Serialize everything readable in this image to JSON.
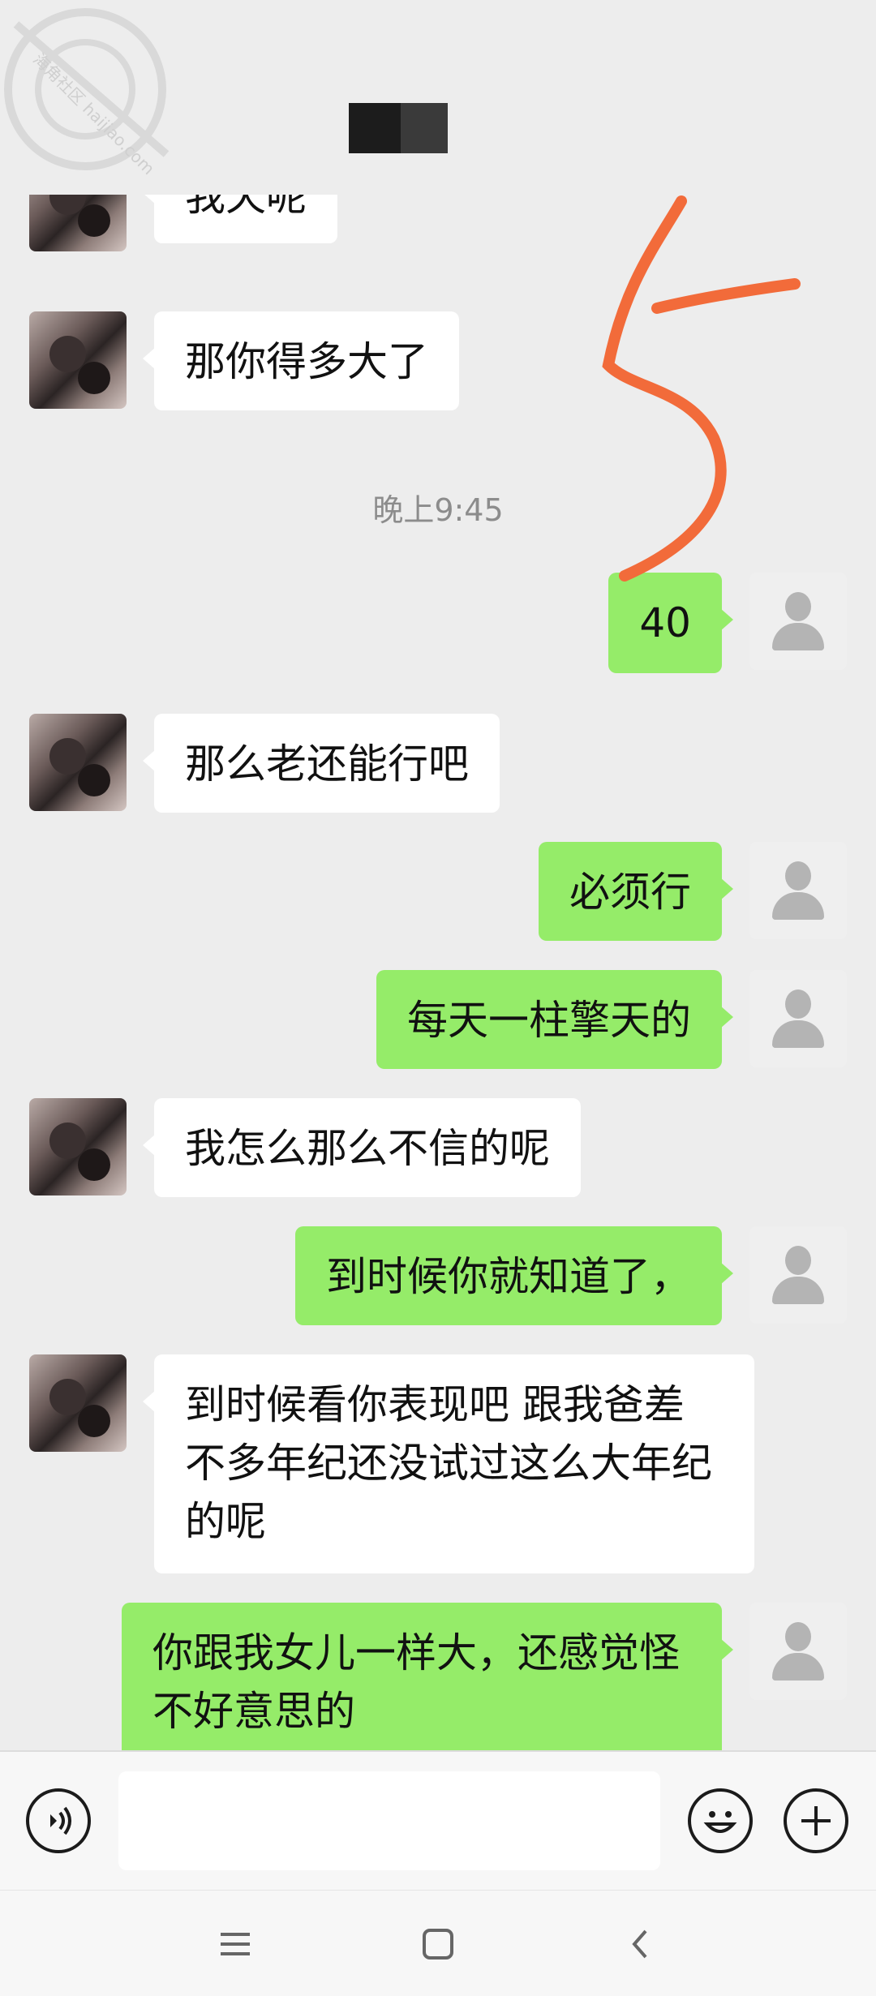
{
  "header": {
    "title": "",
    "watermark_text": "海角社区 haijiao.com"
  },
  "messages": [
    {
      "side": "left",
      "text": "我天呢"
    },
    {
      "side": "left",
      "text": "那你得多大了"
    },
    {
      "type": "time",
      "text": "晚上9:45"
    },
    {
      "side": "right",
      "text": "40"
    },
    {
      "side": "left",
      "text": "那么老还能行吧"
    },
    {
      "side": "right",
      "text": "必须行"
    },
    {
      "side": "right",
      "text": "每天一柱擎天的"
    },
    {
      "side": "left",
      "text": "我怎么那么不信的呢"
    },
    {
      "side": "right",
      "text": "到时候你就知道了，"
    },
    {
      "side": "left",
      "text": "到时候看你表现吧  跟我爸差不多年纪还没试过这么大年纪的呢"
    },
    {
      "side": "right",
      "text": "你跟我女儿一样大，还感觉怪不好意思的"
    }
  ],
  "annotation": {
    "color": "#f26b3a"
  },
  "input": {
    "placeholder": ""
  },
  "colors": {
    "bubble_self": "#95ec69",
    "bubble_other": "#ffffff",
    "background": "#ededed"
  }
}
